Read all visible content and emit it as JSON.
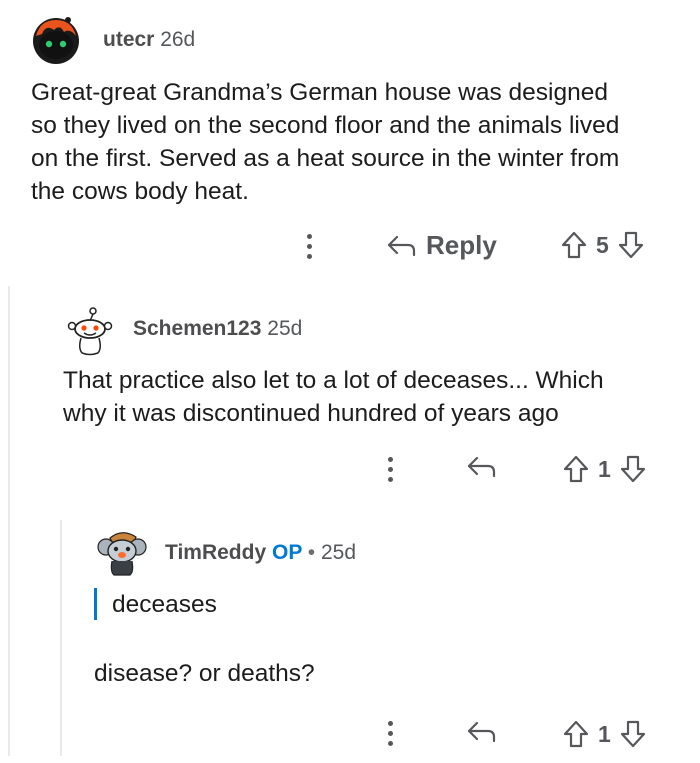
{
  "comments": [
    {
      "username": "utecr",
      "age": "26d",
      "body_lines": [
        "Great-great Grandma’s German house was designed",
        "so they lived on the second floor and the animals lived",
        "on the first. Served as a heat source in the winter from",
        "the cows body heat."
      ],
      "reply_label": "Reply",
      "votes": "5"
    },
    {
      "username": "Schemen123",
      "age": "25d",
      "body_lines": [
        "That practice also let to a lot of deceases... Which",
        "why it was discontinued hundred of years ago"
      ],
      "votes": "1"
    },
    {
      "username": "TimReddy",
      "op_badge": "OP",
      "separator": "•",
      "age": "25d",
      "quote": "deceases",
      "body": "disease? or deaths?",
      "votes": "1"
    }
  ],
  "colors": {
    "accent": "#0079d3",
    "meta": "#55575a",
    "thread_line": "#e8eaec"
  },
  "icons": [
    "avatar-orange-hair",
    "avatar-snoo",
    "avatar-koala-hat",
    "more-options-icon",
    "reply-icon",
    "upvote-icon",
    "downvote-icon"
  ]
}
